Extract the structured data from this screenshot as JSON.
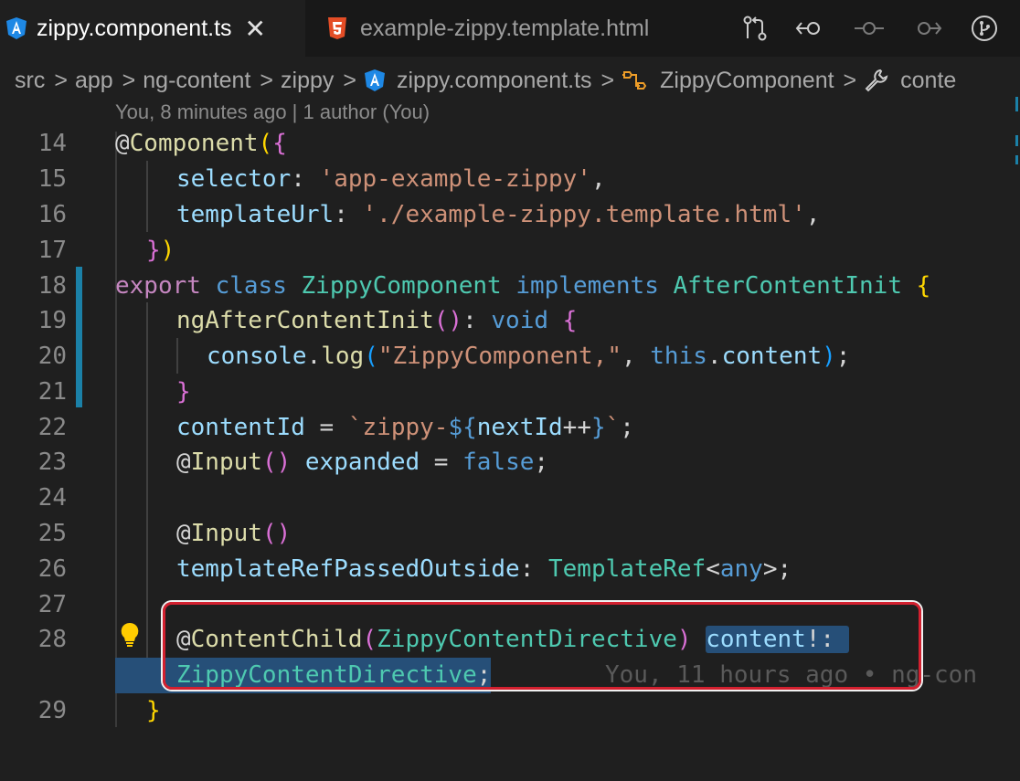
{
  "tabs": [
    {
      "label": "zippy.component.ts",
      "active": true,
      "icon": "angular-icon"
    },
    {
      "label": "example-zippy.template.html",
      "active": false,
      "icon": "html5-icon"
    }
  ],
  "tab_close_glyph": "✕",
  "actions": [
    "open-changes-icon",
    "go-back-icon",
    "timeline-icon",
    "go-forward-icon",
    "source-control-icon"
  ],
  "breadcrumb": {
    "items": [
      "src",
      "app",
      "ng-content",
      "zippy",
      "zippy.component.ts",
      "ZippyComponent",
      "conte"
    ],
    "separator": ">"
  },
  "codelens": "You, 8 minutes ago | 1 author (You)",
  "blame": "You, 11 hours ago • ng-con",
  "line_numbers": [
    "14",
    "15",
    "16",
    "17",
    "18",
    "19",
    "20",
    "21",
    "22",
    "23",
    "24",
    "25",
    "26",
    "27",
    "28",
    "29"
  ],
  "code": {
    "l14": {
      "at": "@",
      "dec": "Component",
      "p1": "(",
      "p2": "{"
    },
    "l15": {
      "key": "selector",
      "colon": ": ",
      "val": "'app-example-zippy'",
      "comma": ","
    },
    "l16": {
      "key": "templateUrl",
      "colon": ": ",
      "val": "'./example-zippy.template.html'",
      "comma": ","
    },
    "l17": {
      "close1": "}",
      "close2": ")"
    },
    "l18": {
      "export": "export",
      "class": "class",
      "name": "ZippyComponent",
      "implements": "implements",
      "iface": "AfterContentInit",
      "brace": "{"
    },
    "l19": {
      "fn": "ngAfterContentInit",
      "paren": "()",
      "colon": ": ",
      "type": "void",
      "brace": "{"
    },
    "l20": {
      "obj": "console",
      "dot": ".",
      "fn": "log",
      "p1": "(",
      "str": "\"ZippyComponent,\"",
      "comma": ", ",
      "this": "this",
      "dot2": ".",
      "prop": "content",
      "p2": ")",
      "semi": ";"
    },
    "l21": {
      "brace": "}"
    },
    "l22": {
      "prop": "contentId",
      "eq": " = ",
      "tick": "`",
      "tmpl": "zippy-",
      "open": "${",
      "var": "nextId",
      "op": "++",
      "close": "}",
      "tick2": "`",
      "semi": ";"
    },
    "l23": {
      "at": "@",
      "dec": "Input",
      "paren": "()",
      "prop": "expanded",
      "eq": " = ",
      "val": "false",
      "semi": ";"
    },
    "l25": {
      "at": "@",
      "dec": "Input",
      "paren": "()"
    },
    "l26": {
      "prop": "templateRefPassedOutside",
      "colon": ": ",
      "type": "TemplateRef",
      "lt": "<",
      "any": "any",
      "gt": ">",
      "semi": ";"
    },
    "l28": {
      "at": "@",
      "dec": "ContentChild",
      "p1": "(",
      "arg": "ZippyContentDirective",
      "p2": ")",
      "prop": "content",
      "bang": "!:",
      "type": "ZippyContentDirective",
      "semi": ";"
    },
    "l29": {
      "brace": "}"
    }
  }
}
